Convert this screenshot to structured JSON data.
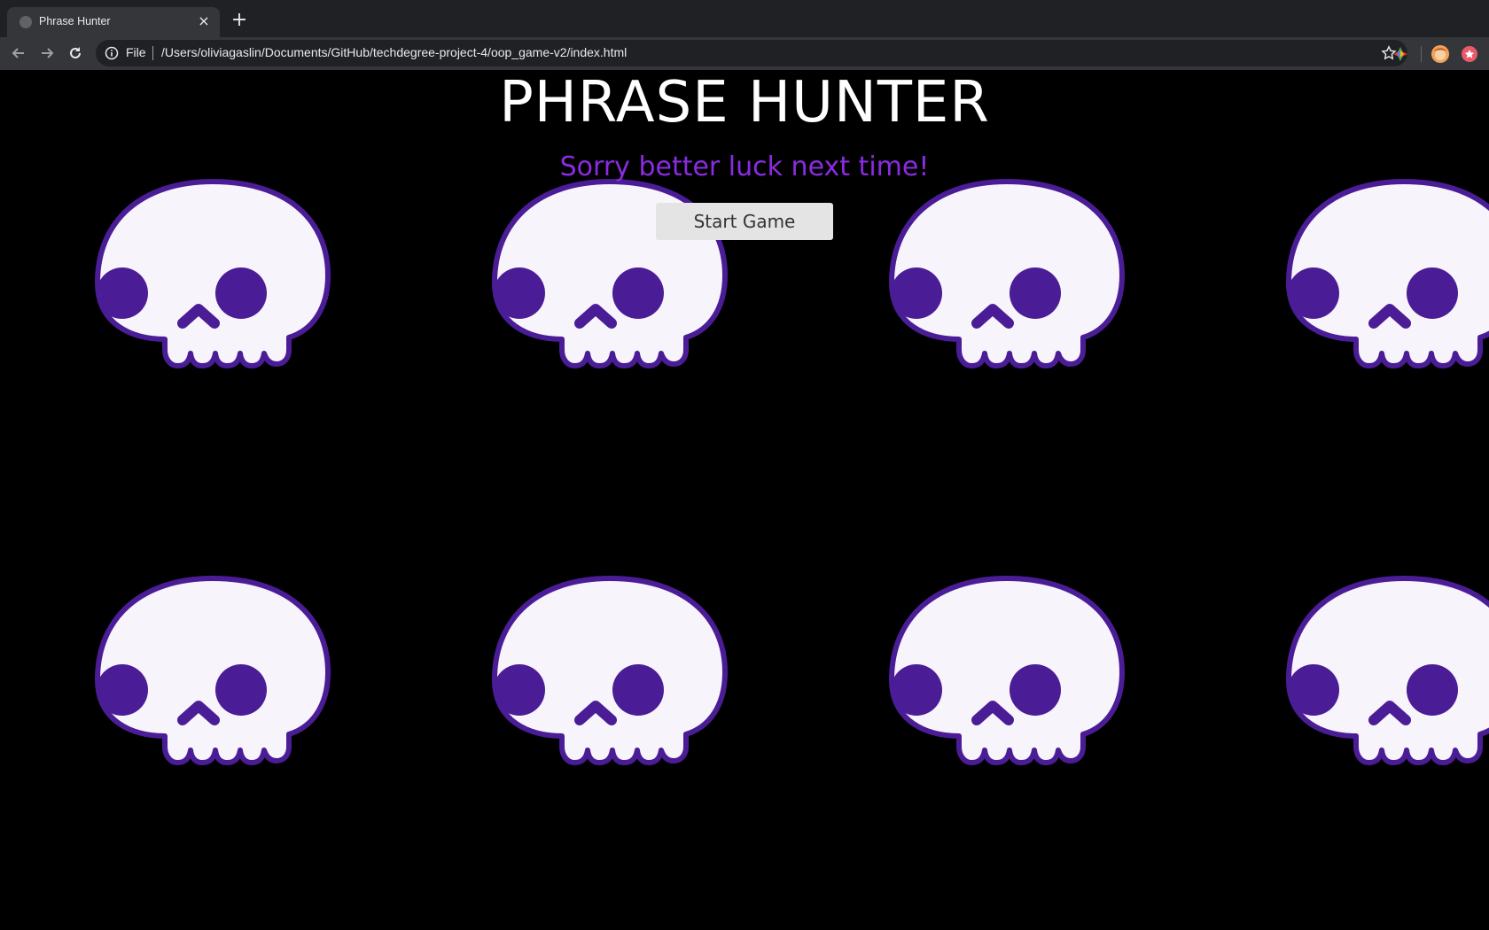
{
  "browser": {
    "tab_title": "Phrase Hunter",
    "tab_close": "×",
    "new_tab": "+",
    "scheme_label": "File",
    "url": "/Users/oliviagaslin/Documents/GitHub/techdegree-project-4/oop_game-v2/index.html"
  },
  "page": {
    "title": "PHRASE HUNTER",
    "message": "Sorry better luck next time!",
    "start_button": "Start Game"
  },
  "colors": {
    "background": "#000000",
    "message": "#8a2be2",
    "skull_fill": "#f8f4fb",
    "skull_outline": "#4a1d96"
  }
}
